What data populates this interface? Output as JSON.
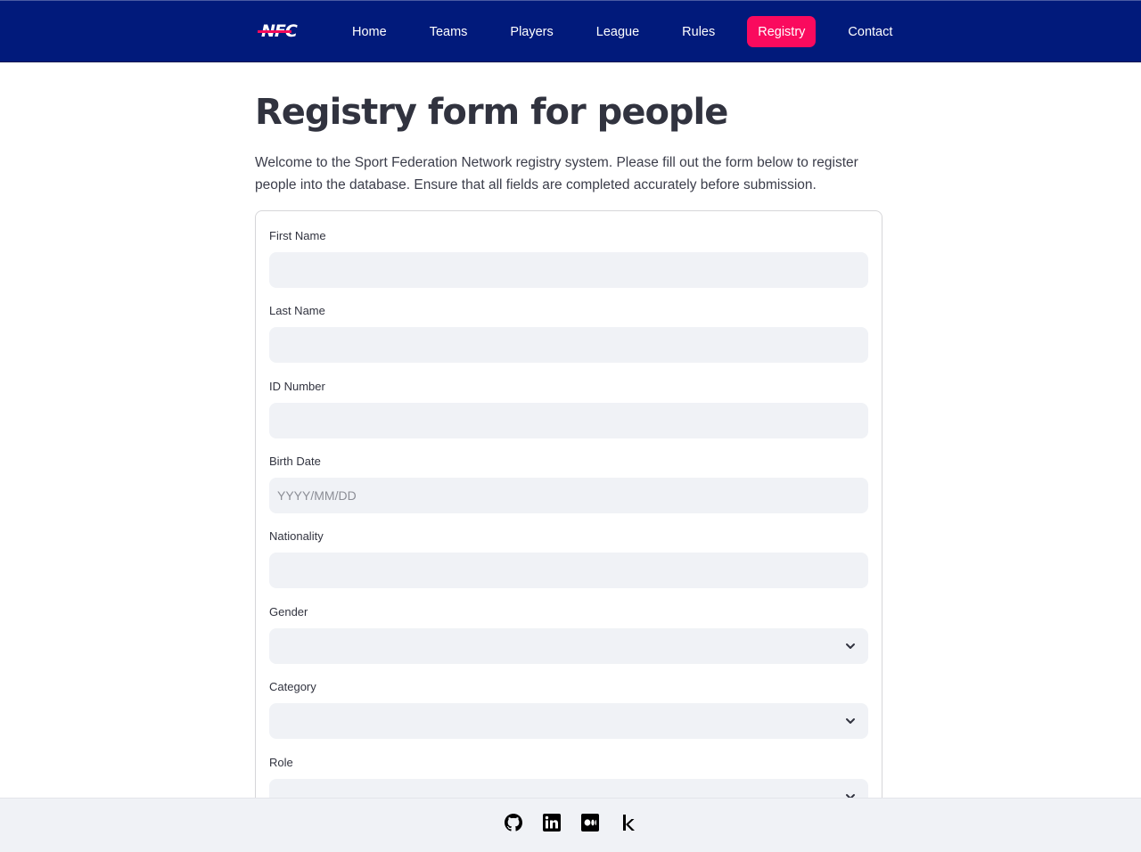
{
  "nav": {
    "logo_text": "NFC",
    "items": [
      {
        "label": "Home"
      },
      {
        "label": "Teams"
      },
      {
        "label": "Players"
      },
      {
        "label": "League"
      },
      {
        "label": "Rules"
      },
      {
        "label": "Registry",
        "active": true
      },
      {
        "label": "Contact"
      }
    ],
    "colors": {
      "bar": "#011a7b",
      "active": "#fa0a5e"
    }
  },
  "page": {
    "title": "Registry form for people",
    "intro": "Welcome to the Sport Federation Network registry system. Please fill out the form below to register people into the database. Ensure that all fields are completed accurately before submission."
  },
  "form": {
    "fields": [
      {
        "label": "First Name",
        "value": "",
        "placeholder": ""
      },
      {
        "label": "Last Name",
        "value": "",
        "placeholder": ""
      },
      {
        "label": "ID Number",
        "value": "",
        "placeholder": ""
      },
      {
        "label": "Birth Date",
        "value": "",
        "placeholder": "YYYY/MM/DD"
      },
      {
        "label": "Nationality",
        "value": "",
        "placeholder": ""
      },
      {
        "label": "Gender",
        "value": ""
      },
      {
        "label": "Category",
        "value": ""
      },
      {
        "label": "Role",
        "value": ""
      }
    ]
  },
  "footer": {
    "icons": [
      "github-icon",
      "linkedin-icon",
      "medium-icon",
      "kaggle-icon"
    ]
  }
}
